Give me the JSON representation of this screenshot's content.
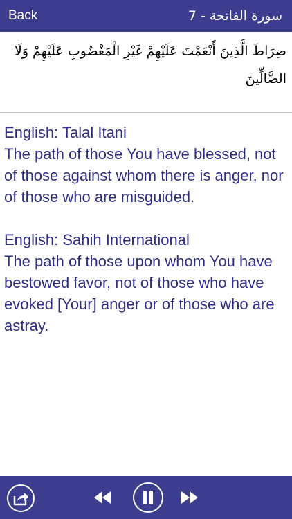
{
  "header": {
    "back_label": "Back",
    "title": "سورة الفاتحة - 7"
  },
  "verse": {
    "arabic": "صِرَاطَ الَّذِينَ أَنْعَمْتَ عَلَيْهِمْ غَيْرِ الْمَغْضُوبِ عَلَيْهِمْ وَلَا الضَّالِّينَ"
  },
  "translations": [
    {
      "source": "English: Talal Itani",
      "text": "The path of those You have blessed, not of those against whom there is anger, nor of those who are misguided."
    },
    {
      "source": "English: Sahih International",
      "text": "The path of those upon whom You have bestowed favor, not of those who have evoked [Your] anger or of those who are astray."
    }
  ],
  "footer": {
    "icons": [
      "share-icon",
      "rewind-icon",
      "pause-icon",
      "fast-forward-icon"
    ]
  },
  "colors": {
    "bar": "#3d3d8f",
    "translation_text": "#2e2e88",
    "arabic_text": "#000000",
    "bar_text": "#ffffff"
  }
}
